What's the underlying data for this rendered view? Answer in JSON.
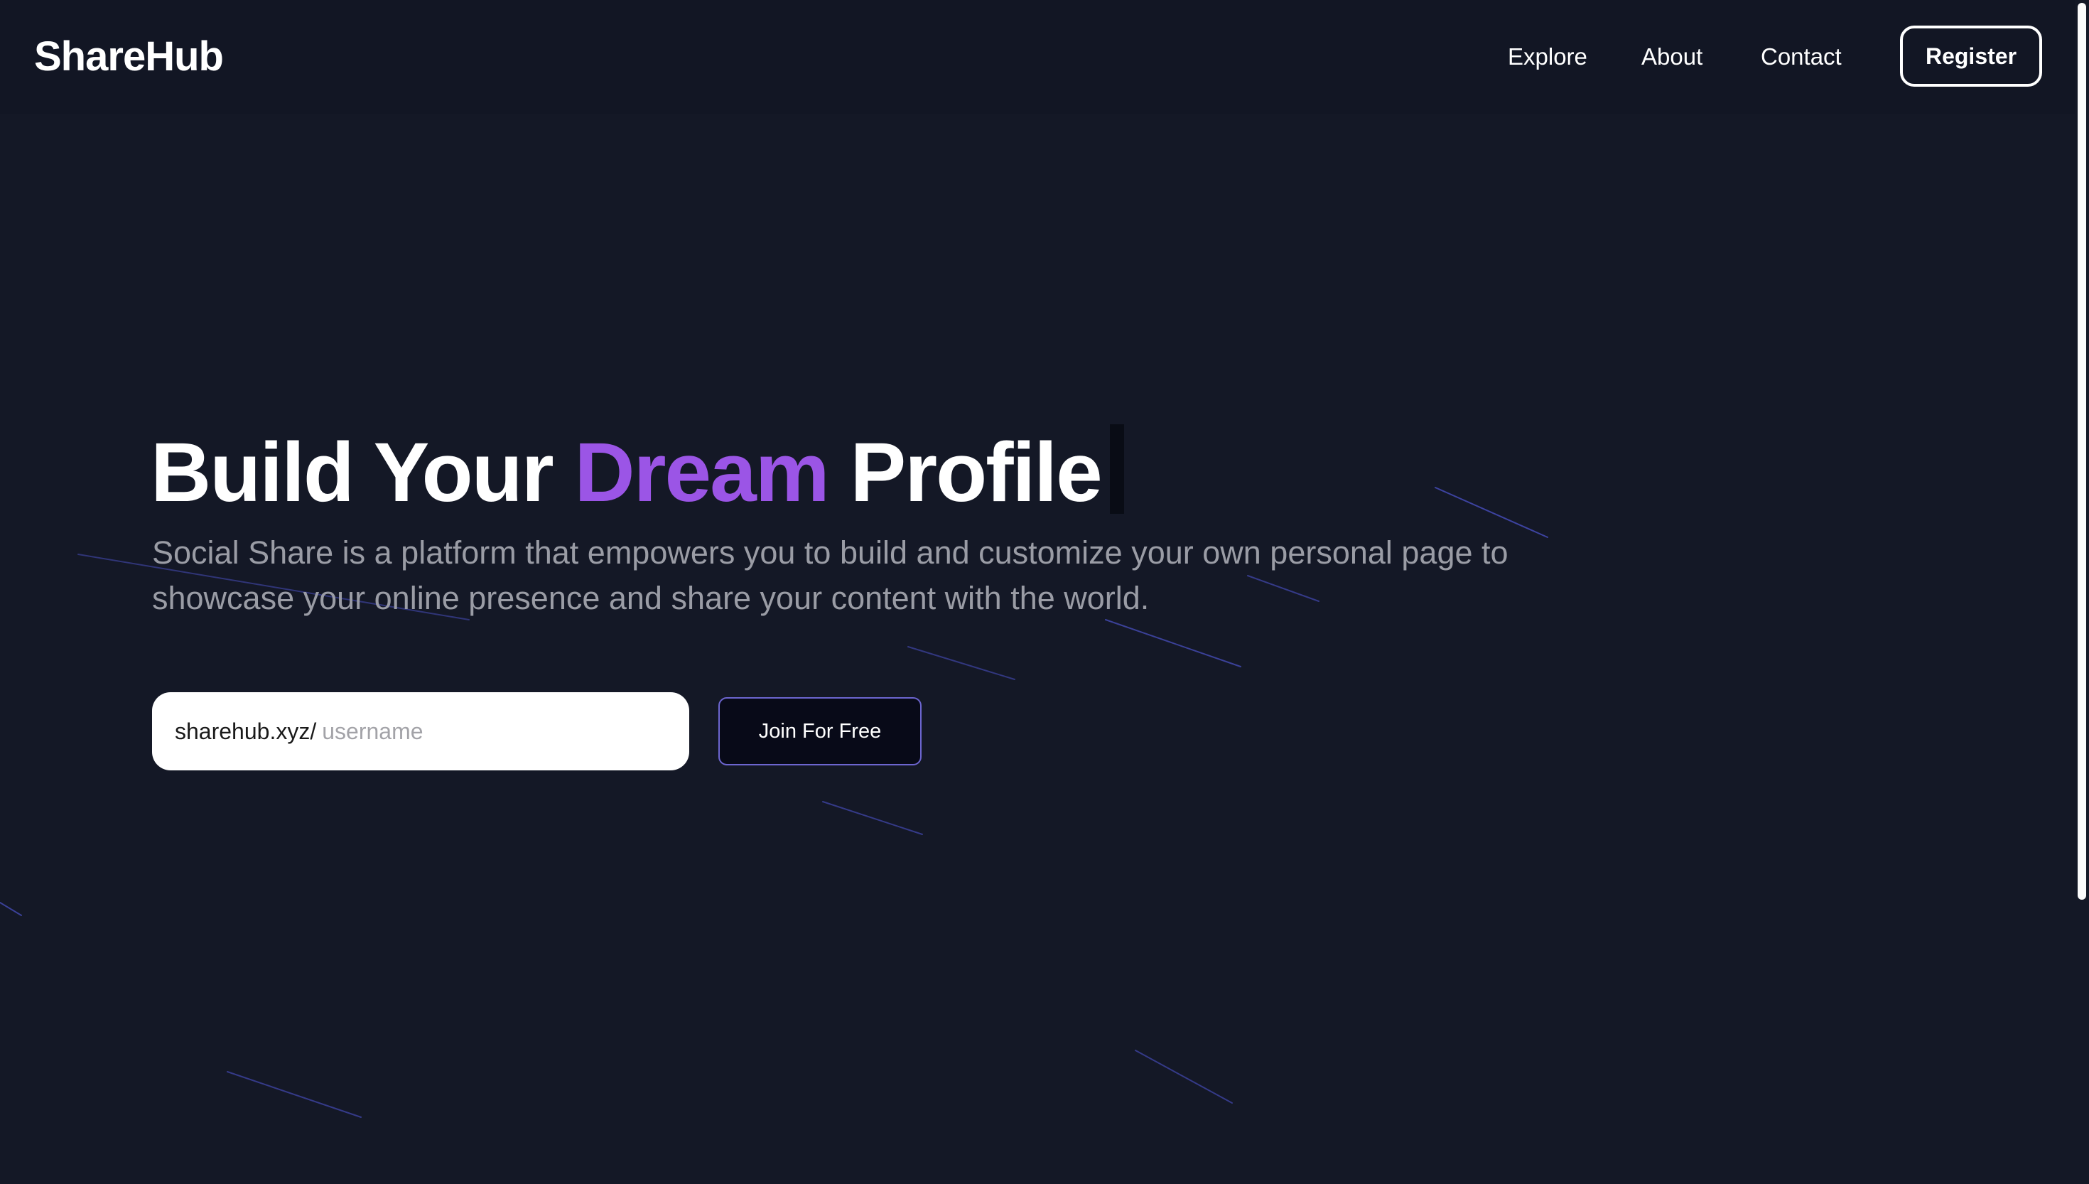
{
  "brand": {
    "logo": "ShareHub"
  },
  "nav": {
    "links": [
      "Explore",
      "About",
      "Contact"
    ],
    "register_label": "Register"
  },
  "hero": {
    "title_part1": "Build Your ",
    "title_accent": "Dream",
    "title_part2": " Profile",
    "description": "Social Share is a platform that empowers you to build and customize your own personal page to showcase your online presence and share your content with the world.",
    "url_prefix": "sharehub.xyz/",
    "username_placeholder": "username",
    "username_value": "",
    "join_label": "Join For Free"
  },
  "colors": {
    "background": "#141826",
    "navbar": "#121624",
    "accent": "#9b55e6",
    "text": "#ffffff",
    "muted_text": "#9a9ca5",
    "button_border": "#6c65cf",
    "button_bg": "#080a18",
    "streak": "#4b52c9"
  }
}
